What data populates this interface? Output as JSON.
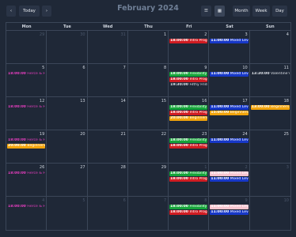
{
  "toolbar": {
    "prev_icon": "‹",
    "today_label": "Today",
    "next_icon": "›",
    "title": "February 2024",
    "list_icon": "list-icon",
    "grid_icon": "grid-icon",
    "list_glyph": "☰",
    "grid_glyph": "▦",
    "month_label": "Month",
    "week_label": "Week",
    "day_label": "Day"
  },
  "weekdays": [
    "Mon",
    "Tue",
    "Wed",
    "Thu",
    "Fri",
    "Sat",
    "Sun"
  ],
  "weeks": [
    [
      {
        "day": "29",
        "other": true,
        "events": []
      },
      {
        "day": "30",
        "other": true,
        "events": []
      },
      {
        "day": "31",
        "other": true,
        "events": []
      },
      {
        "day": "1",
        "other": false,
        "events": []
      },
      {
        "day": "2",
        "other": false,
        "events": [
          {
            "time": "18:00:00",
            "title": "Intro Progre",
            "style": "ev-red"
          }
        ]
      },
      {
        "day": "3",
        "other": false,
        "events": [
          {
            "time": "11:00:00",
            "title": "Mixed Level F",
            "style": "ev-blue"
          }
        ]
      },
      {
        "day": "4",
        "other": false,
        "events": []
      }
    ],
    [
      {
        "day": "5",
        "other": false,
        "events": [
          {
            "time": "18:00:00",
            "title": "Fierce & Fun",
            "style": "ev-plain-pink"
          }
        ]
      },
      {
        "day": "6",
        "other": false,
        "events": []
      },
      {
        "day": "7",
        "other": false,
        "events": []
      },
      {
        "day": "8",
        "other": false,
        "events": []
      },
      {
        "day": "9",
        "other": false,
        "events": [
          {
            "time": "18:00:00",
            "title": "Flexibility Flo",
            "style": "ev-green"
          },
          {
            "time": "18:00:00",
            "title": "Intro Progre",
            "style": "ev-red"
          },
          {
            "time": "19:30:00",
            "title": "Filthy Friday",
            "style": "ev-plain-white"
          }
        ]
      },
      {
        "day": "10",
        "other": false,
        "events": [
          {
            "time": "11:00:00",
            "title": "Mixed Level F",
            "style": "ev-blue"
          }
        ]
      },
      {
        "day": "11",
        "other": false,
        "events": [
          {
            "time": "13:30:00",
            "title": "Valentine's C",
            "style": "ev-plain-white"
          }
        ]
      }
    ],
    [
      {
        "day": "12",
        "other": false,
        "events": [
          {
            "time": "18:00:00",
            "title": "Fierce & Fun",
            "style": "ev-plain-pink"
          }
        ]
      },
      {
        "day": "13",
        "other": false,
        "events": []
      },
      {
        "day": "14",
        "other": false,
        "events": []
      },
      {
        "day": "15",
        "other": false,
        "events": []
      },
      {
        "day": "16",
        "other": false,
        "events": [
          {
            "time": "18:00:00",
            "title": "Flexibility Flo",
            "style": "ev-green"
          },
          {
            "time": "18:00:00",
            "title": "Intro Progre",
            "style": "ev-red"
          },
          {
            "time": "20:00:00",
            "title": "Beginners P",
            "style": "ev-orange"
          }
        ]
      },
      {
        "day": "17",
        "other": false,
        "events": [
          {
            "time": "11:00:00",
            "title": "Mixed Level F",
            "style": "ev-blue"
          },
          {
            "time": "15:00:00",
            "title": "Beginners P",
            "style": "ev-orange"
          }
        ]
      },
      {
        "day": "18",
        "other": false,
        "events": [
          {
            "time": "13:00:00",
            "title": "Beginners P",
            "style": "ev-orange"
          }
        ]
      }
    ],
    [
      {
        "day": "19",
        "other": false,
        "events": [
          {
            "time": "18:00:00",
            "title": "Fierce & Fun",
            "style": "ev-plain-pink"
          },
          {
            "time": "20:00:00",
            "title": "Beginners P",
            "style": "ev-orange"
          }
        ]
      },
      {
        "day": "20",
        "other": false,
        "events": []
      },
      {
        "day": "21",
        "other": false,
        "events": []
      },
      {
        "day": "22",
        "other": false,
        "events": []
      },
      {
        "day": "23",
        "other": false,
        "events": [
          {
            "time": "18:00:00",
            "title": "Flexibility Flo",
            "style": "ev-green"
          },
          {
            "time": "18:00:00",
            "title": "Intro Progre",
            "style": "ev-red"
          }
        ]
      },
      {
        "day": "24",
        "other": false,
        "events": [
          {
            "time": "11:00:00",
            "title": "Mixed Level F",
            "style": "ev-blue"
          }
        ]
      },
      {
        "day": "25",
        "other": false,
        "events": []
      }
    ],
    [
      {
        "day": "26",
        "other": false,
        "events": [
          {
            "time": "18:00:00",
            "title": "Fierce & Fun",
            "style": "ev-plain-pink"
          }
        ]
      },
      {
        "day": "27",
        "other": false,
        "events": []
      },
      {
        "day": "28",
        "other": false,
        "events": []
      },
      {
        "day": "29",
        "other": false,
        "events": []
      },
      {
        "day": "1",
        "other": true,
        "events": [
          {
            "time": "18:00:00",
            "title": "Flexibility Flo",
            "style": "ev-green"
          },
          {
            "time": "18:00:00",
            "title": "Intro Progre",
            "style": "ev-red"
          }
        ]
      },
      {
        "day": "2",
        "other": true,
        "events": [
          {
            "time": "11:00:00",
            "title": "Mixed Level F",
            "style": "ev-pink"
          },
          {
            "time": "11:00:00",
            "title": "Mixed Level F",
            "style": "ev-blue"
          }
        ]
      },
      {
        "day": "3",
        "other": true,
        "events": []
      }
    ],
    [
      {
        "day": "4",
        "other": true,
        "events": [
          {
            "time": "18:00:00",
            "title": "Fierce & Fun",
            "style": "ev-plain-pink"
          }
        ]
      },
      {
        "day": "5",
        "other": true,
        "events": []
      },
      {
        "day": "6",
        "other": true,
        "events": []
      },
      {
        "day": "7",
        "other": true,
        "events": []
      },
      {
        "day": "8",
        "other": true,
        "events": [
          {
            "time": "18:00:00",
            "title": "Flexibility Flo",
            "style": "ev-green"
          },
          {
            "time": "18:00:00",
            "title": "Intro Progre",
            "style": "ev-red"
          }
        ]
      },
      {
        "day": "9",
        "other": true,
        "events": [
          {
            "time": "11:00:00",
            "title": "Mixed Level F",
            "style": "ev-pink"
          },
          {
            "time": "11:00:00",
            "title": "Mixed Level F",
            "style": "ev-blue"
          }
        ]
      },
      {
        "day": "10",
        "other": true,
        "events": []
      }
    ]
  ]
}
